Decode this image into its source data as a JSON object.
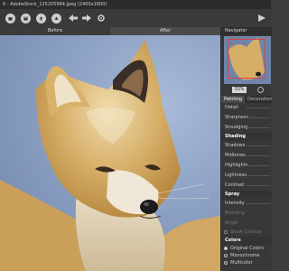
{
  "window": {
    "title": "0 - AdobeStock_125205964.jpeg (2400x1800)"
  },
  "toolbar": {
    "buttons": [
      "open-icon",
      "save-icon",
      "export-icon",
      "share-icon",
      "undo-icon",
      "redo-icon",
      "settings-icon",
      "run-icon"
    ]
  },
  "viewer": {
    "tab_before": "Before",
    "tab_after": "After"
  },
  "navigator": {
    "title": "Navigator",
    "zoom": "33%"
  },
  "panel": {
    "tabs": [
      "Painting",
      "Decoration"
    ],
    "rows": [
      {
        "label": "Detail",
        "kind": "slider"
      },
      {
        "label": "Sharpness",
        "kind": "slider"
      },
      {
        "label": "Smudging",
        "kind": "slider"
      },
      {
        "label": "Shading",
        "kind": "section"
      },
      {
        "label": "Shadows",
        "kind": "slider"
      },
      {
        "label": "Midtones",
        "kind": "slider"
      },
      {
        "label": "Highlights",
        "kind": "slider"
      },
      {
        "label": "Lightness",
        "kind": "slider"
      },
      {
        "label": "Contrast",
        "kind": "slider"
      },
      {
        "label": "Spray",
        "kind": "section"
      },
      {
        "label": "Intensity",
        "kind": "slider"
      },
      {
        "label": "Blending",
        "kind": "dim"
      },
      {
        "label": "Angle",
        "kind": "dim"
      },
      {
        "label": "Show Contour",
        "kind": "check"
      },
      {
        "label": "Colors",
        "kind": "section"
      }
    ],
    "color_options": [
      {
        "label": "Original Colors",
        "selected": true
      },
      {
        "label": "Monochrome",
        "selected": false
      },
      {
        "label": "Multicolor",
        "selected": false
      }
    ]
  },
  "colors": {
    "accent_nav_rect": "#e04040",
    "panel_bg": "#383838",
    "sky": "#8ea3c6",
    "fur": "#d8b26a"
  }
}
